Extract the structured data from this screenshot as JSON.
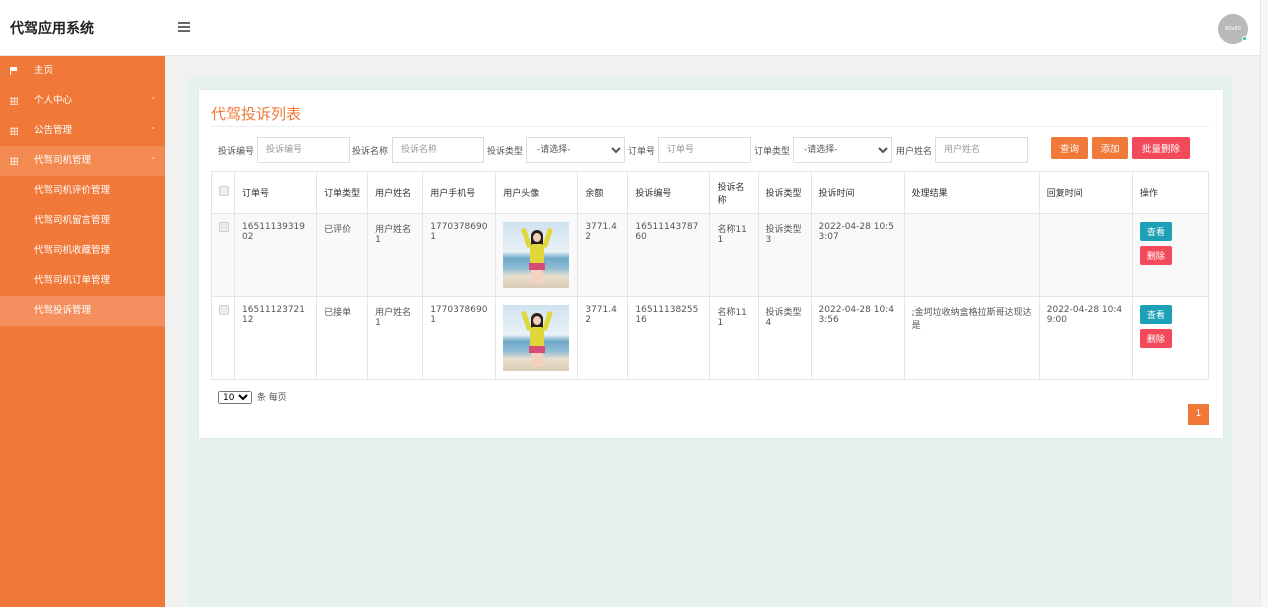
{
  "header": {
    "brand": "代驾应用系统",
    "avatar_text": "80x80"
  },
  "sidebar": {
    "items": [
      {
        "label": "主页",
        "icon": "flag-icon"
      },
      {
        "label": "个人中心",
        "icon": "grid-icon",
        "caret": "˅"
      },
      {
        "label": "公告管理",
        "icon": "grid-icon",
        "caret": "˅"
      },
      {
        "label": "代驾司机管理",
        "icon": "grid-icon",
        "caret": "˄"
      }
    ],
    "subitems": [
      {
        "label": "代驾司机评价管理"
      },
      {
        "label": "代驾司机留言管理"
      },
      {
        "label": "代驾司机收藏管理"
      },
      {
        "label": "代驾司机订单管理"
      },
      {
        "label": "代驾投诉管理"
      }
    ]
  },
  "main": {
    "title": "代驾投诉列表",
    "search": {
      "complaint_no_label": "投诉编号",
      "complaint_no_placeholder": "投诉编号",
      "complaint_name_label": "投诉名称",
      "complaint_name_placeholder": "投诉名称",
      "complaint_type_label": "投诉类型",
      "complaint_type_value": "-请选择-",
      "order_no_label": "订单号",
      "order_no_placeholder": "订单号",
      "order_type_label": "订单类型",
      "order_type_value": "-请选择-",
      "user_name_label": "用户姓名",
      "user_name_placeholder": "用户姓名",
      "query_button": "查询",
      "add_button": "添加",
      "batch_delete_button": "批量删除"
    },
    "table": {
      "headers": [
        "",
        "订单号",
        "订单类型",
        "用户姓名",
        "用户手机号",
        "用户头像",
        "余额",
        "投诉编号",
        "投诉名称",
        "投诉类型",
        "投诉时间",
        "处理结果",
        "回复时间",
        "操作"
      ],
      "rows": [
        {
          "order_no": "1651113931902",
          "order_type": "已评价",
          "user_name": "用户姓名1",
          "phone": "17703786901",
          "balance": "3771.42",
          "complaint_no": "1651114378760",
          "complaint_name": "名称111",
          "complaint_type": "投诉类型3",
          "complaint_time": "2022-04-28 10:53:07",
          "result": "",
          "reply_time": "",
          "view": "查看",
          "delete": "删除"
        },
        {
          "order_no": "1651112372112",
          "order_type": "已接单",
          "user_name": "用户姓名1",
          "phone": "17703786901",
          "balance": "3771.42",
          "complaint_no": "1651113825516",
          "complaint_name": "名称111",
          "complaint_type": "投诉类型4",
          "complaint_time": "2022-04-28 10:43:56",
          "result": ";金坷垃收纳盒格拉斯哥达现达是",
          "reply_time": "2022-04-28 10:49:00",
          "view": "查看",
          "delete": "删除"
        }
      ]
    },
    "pagination": {
      "page_size": "10",
      "per_page_text": "条 每页",
      "current_page": "1"
    }
  }
}
